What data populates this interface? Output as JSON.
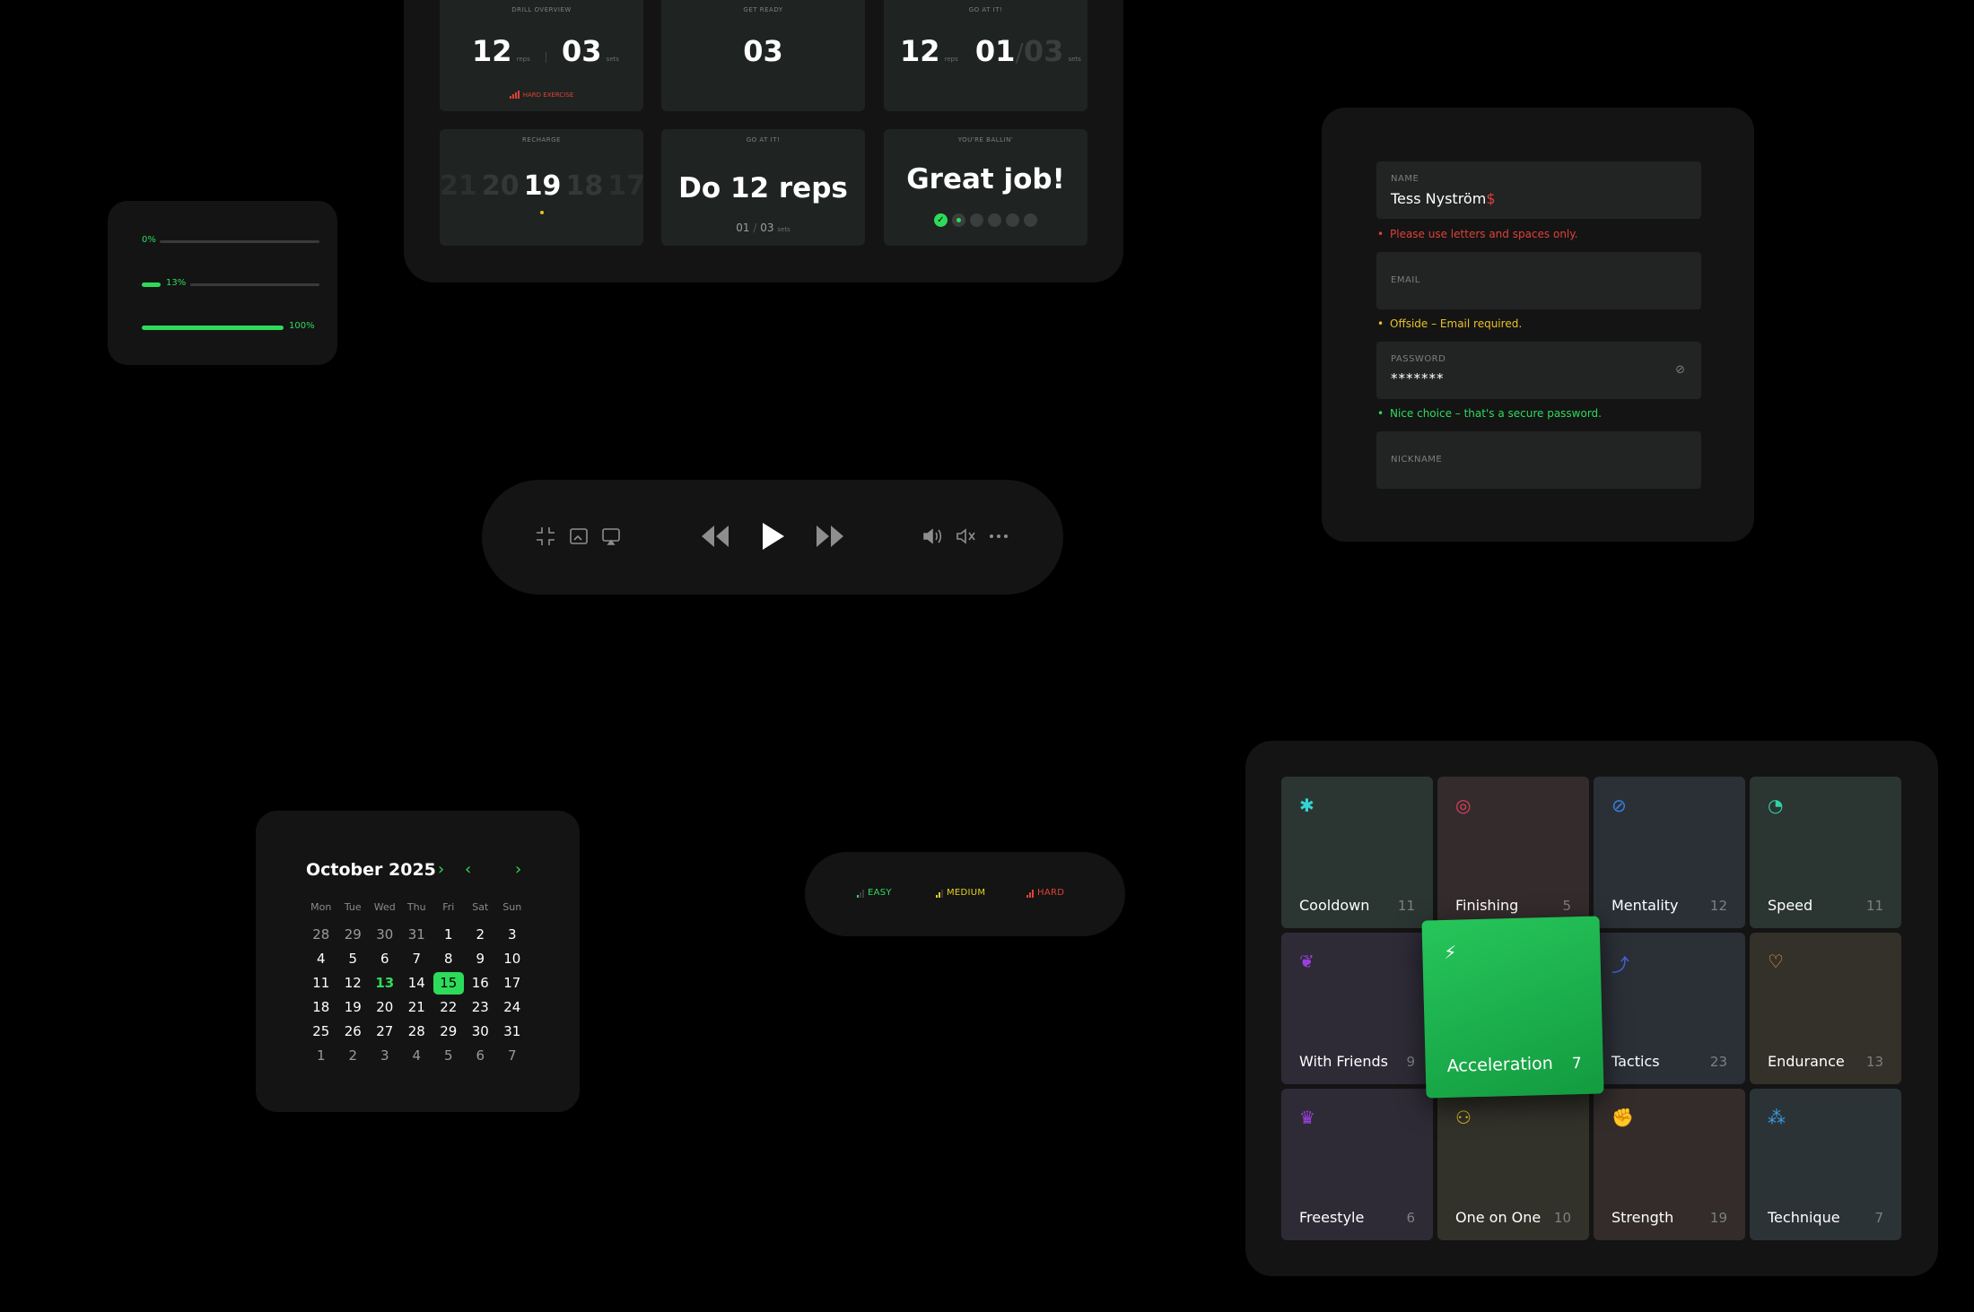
{
  "drill": {
    "overview": {
      "label": "DRILL OVERVIEW",
      "reps": "12",
      "reps_unit": "reps",
      "sets": "03",
      "sets_unit": "sets",
      "difficulty": "HARD EXERCISE"
    },
    "get_ready": {
      "label": "GET READY",
      "count": "03"
    },
    "go_at_it_1": {
      "label": "GO AT IT!",
      "reps": "12",
      "reps_unit": "reps",
      "set_current": "01",
      "set_total": "03",
      "sets_unit": "sets"
    },
    "recharge": {
      "label": "RECHARGE",
      "prev2": "21",
      "prev1": "20",
      "current": "19",
      "next1": "18",
      "next2": "17"
    },
    "go_at_it_2": {
      "label": "GO AT IT!",
      "title": "Do 12 reps",
      "set_current": "01",
      "set_total": "03",
      "sets_unit": "sets"
    },
    "ballin": {
      "label": "YOU'RE BALLIN'",
      "title": "Great job!"
    }
  },
  "progress": [
    {
      "label": "0%",
      "value": 0
    },
    {
      "label": "13%",
      "value": 13
    },
    {
      "label": "100%",
      "value": 100
    }
  ],
  "form": {
    "name": {
      "label": "NAME",
      "value": "Tess Nyström",
      "invalid_char": "$",
      "message": "Please use letters and spaces only."
    },
    "email": {
      "label": "EMAIL",
      "message": "Offside – Email required."
    },
    "password": {
      "label": "PASSWORD",
      "value": "*******",
      "message": "Nice choice – that's a secure password."
    },
    "nickname": {
      "label": "NICKNAME"
    }
  },
  "calendar": {
    "title": "October 2025",
    "weekdays": [
      "Mon",
      "Tue",
      "Wed",
      "Thu",
      "Fri",
      "Sat",
      "Sun"
    ],
    "weeks": [
      [
        "28",
        "29",
        "30",
        "31",
        "1",
        "2",
        "3"
      ],
      [
        "4",
        "5",
        "6",
        "7",
        "8",
        "9",
        "10"
      ],
      [
        "11",
        "12",
        "13",
        "14",
        "15",
        "16",
        "17"
      ],
      [
        "18",
        "19",
        "20",
        "21",
        "22",
        "23",
        "24"
      ],
      [
        "25",
        "26",
        "27",
        "28",
        "29",
        "30",
        "31"
      ],
      [
        "1",
        "2",
        "3",
        "4",
        "5",
        "6",
        "7"
      ]
    ],
    "today": "13",
    "selected": "15"
  },
  "difficulty": [
    {
      "label": "EASY",
      "color": "#2ddb5b",
      "level": 1
    },
    {
      "label": "MEDIUM",
      "color": "#e6d31e",
      "level": 2
    },
    {
      "label": "HARD",
      "color": "#e0413a",
      "level": 3
    }
  ],
  "categories": [
    {
      "name": "Cooldown",
      "count": "11",
      "icon": "asterisk-icon",
      "glyph": "✱",
      "color": "#35d4d4",
      "bg": "#2b3633"
    },
    {
      "name": "Finishing",
      "count": "5",
      "icon": "target-icon",
      "glyph": "◎",
      "color": "#e0405a",
      "bg": "#332b2c"
    },
    {
      "name": "Mentality",
      "count": "12",
      "icon": "brain-icon",
      "glyph": "⊘",
      "color": "#3b7de0",
      "bg": "#2b3037"
    },
    {
      "name": "Speed",
      "count": "11",
      "icon": "speedometer-icon",
      "glyph": "◔",
      "color": "#2fd1a5",
      "bg": "#2b3532"
    },
    {
      "name": "With Friends",
      "count": "9",
      "icon": "group-icon",
      "glyph": "❦",
      "color": "#9d3fe0",
      "bg": "#2e2b37"
    },
    {
      "name": "Acceleration",
      "count": "7",
      "icon": "lightning-icon",
      "glyph": "⚡",
      "color": "#ffffff",
      "bg": "#1fae4b"
    },
    {
      "name": "Tactics",
      "count": "23",
      "icon": "tactics-icon",
      "glyph": "⤴",
      "color": "#4a64e8",
      "bg": "#2b3037"
    },
    {
      "name": "Endurance",
      "count": "13",
      "icon": "heart-rate-icon",
      "glyph": "♡",
      "color": "#e8a62a",
      "bg": "#34302a"
    },
    {
      "name": "Freestyle",
      "count": "6",
      "icon": "crown-icon",
      "glyph": "♛",
      "color": "#9d3fe0",
      "bg": "#2e2b37"
    },
    {
      "name": "One on One",
      "count": "10",
      "icon": "duo-icon",
      "glyph": "⚇",
      "color": "#e8c22a",
      "bg": "#32322a"
    },
    {
      "name": "Strength",
      "count": "19",
      "icon": "fist-icon",
      "glyph": "✊",
      "color": "#e0513a",
      "bg": "#332c2b"
    },
    {
      "name": "Technique",
      "count": "7",
      "icon": "technique-icon",
      "glyph": "⁂",
      "color": "#3b9be0",
      "bg": "#2b3337"
    }
  ]
}
